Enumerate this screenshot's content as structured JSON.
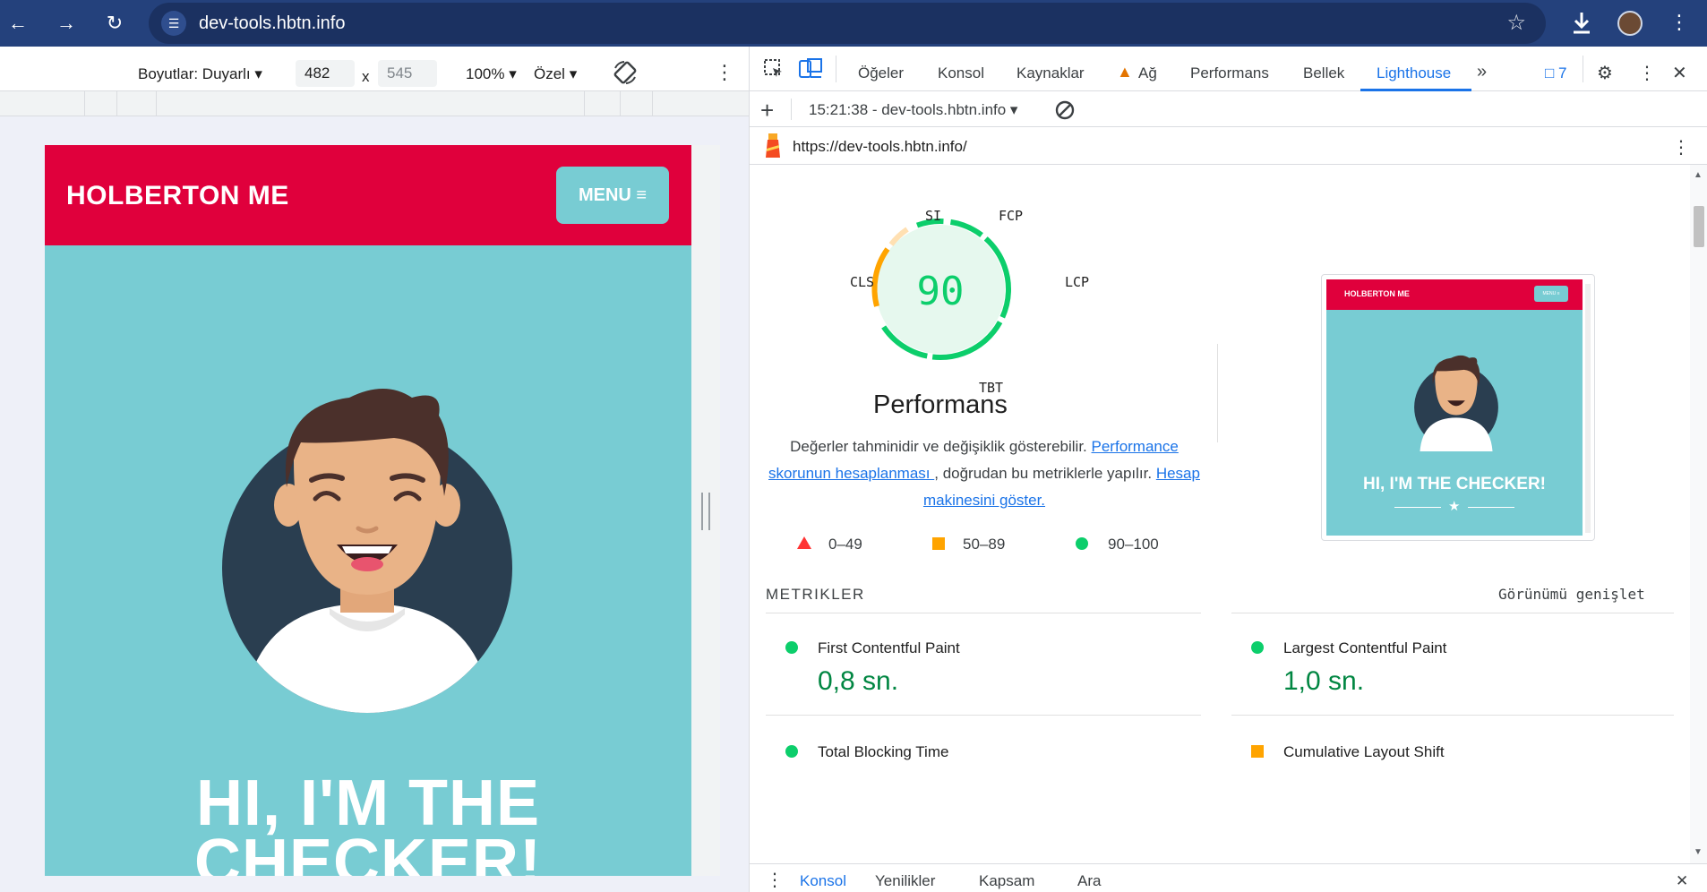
{
  "browser": {
    "url": "dev-tools.hbtn.info"
  },
  "device_toolbar": {
    "dimensions_label": "Boyutlar: Duyarlı",
    "width": "482",
    "height": "545",
    "zoom": "100%",
    "throttle": "Özel",
    "times": "x"
  },
  "page": {
    "logo": "HOLBERTON ME",
    "menu": "MENU ≡",
    "hero_line1": "HI, I'M THE",
    "hero_line2": "CHECKER!"
  },
  "devtools": {
    "tabs": [
      "Öğeler",
      "Konsol",
      "Kaynaklar",
      "Ağ",
      "Performans",
      "Bellek",
      "Lighthouse"
    ],
    "issues_count": "7",
    "report_select": "15:21:38 - dev-tools.hbtn.info",
    "report_url": "https://dev-tools.hbtn.info/"
  },
  "report": {
    "score": "90",
    "gauge_labels": {
      "si": "SI",
      "fcp": "FCP",
      "lcp": "LCP",
      "tbt": "TBT",
      "cls": "CLS"
    },
    "category": "Performans",
    "desc_text1": "Değerler tahminidir ve değişiklik gösterebilir. ",
    "desc_link1": "Performance skorunun hesaplanması ",
    "desc_text2": ", doğrudan bu metriklerle yapılır. ",
    "desc_link2": "Hesap makinesini göster.",
    "legend": [
      {
        "range": "0–49",
        "color": "#ff3333"
      },
      {
        "range": "50–89",
        "color": "#ffa400"
      },
      {
        "range": "90–100",
        "color": "#0cce6b"
      }
    ],
    "thumb": {
      "logo": "HOLBERTON ME",
      "menu": "MENU ≡",
      "title": "HI, I'M THE CHECKER!"
    },
    "metrics_heading": "METRIKLER",
    "expand_view": "Görünümü genişlet",
    "metrics": [
      {
        "name": "First Contentful Paint",
        "value": "0,8 sn.",
        "status": "good"
      },
      {
        "name": "Largest Contentful Paint",
        "value": "1,0 sn.",
        "status": "good"
      },
      {
        "name": "Total Blocking Time",
        "value": "",
        "status": "good"
      },
      {
        "name": "Cumulative Layout Shift",
        "value": "",
        "status": "average"
      }
    ]
  },
  "drawer": {
    "tabs": [
      "Konsol",
      "Yenilikler",
      "Kapsam",
      "Ara"
    ]
  },
  "colors": {
    "chrome_bar": "#24417c",
    "site_red": "#e0003c",
    "site_teal": "#78ccd3",
    "good": "#0cce6b",
    "average": "#ffa400",
    "link": "#1a73e8"
  }
}
